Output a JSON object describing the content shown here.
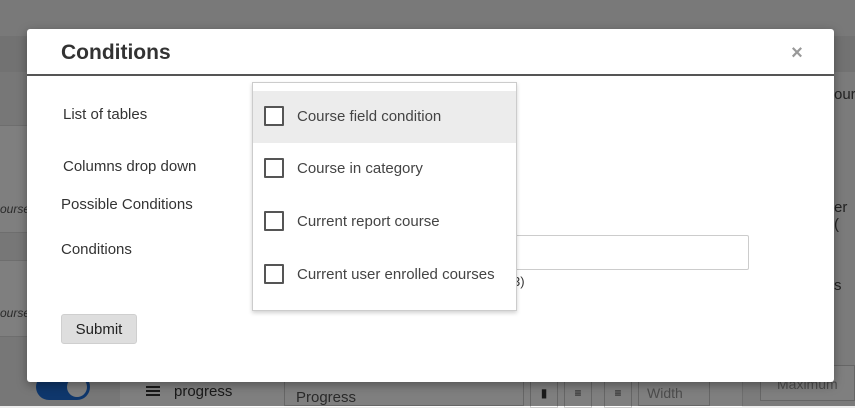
{
  "background": {
    "left_course_text_1": "ourse",
    "left_course_text_2": "ourse",
    "right_text_1": "our",
    "right_text_2": "er (",
    "right_text_3": "s",
    "progress_label": "progress",
    "progress_value": "Progress",
    "width_placeholder": "Width",
    "maximum_placeholder": "Maximum"
  },
  "modal": {
    "title": "Conditions",
    "close_symbol": "×",
    "labels": {
      "list_of_tables": "List of tables",
      "columns_drop_down": "Columns drop down",
      "possible_conditions": "Possible Conditions",
      "conditions": "Conditions"
    },
    "conditions_hint_tail": "3)",
    "submit_label": "Submit"
  },
  "dropdown": {
    "items": [
      {
        "label": "Course field condition",
        "checked": false,
        "highlighted": true
      },
      {
        "label": "Course in category",
        "checked": false,
        "highlighted": false
      },
      {
        "label": "Current report course",
        "checked": false,
        "highlighted": false
      },
      {
        "label": "Current user enrolled courses",
        "checked": false,
        "highlighted": false
      }
    ]
  },
  "colors": {
    "overlay": "#000000",
    "toggle_accent": "#1e6fd9",
    "highlight": "#ececec"
  }
}
